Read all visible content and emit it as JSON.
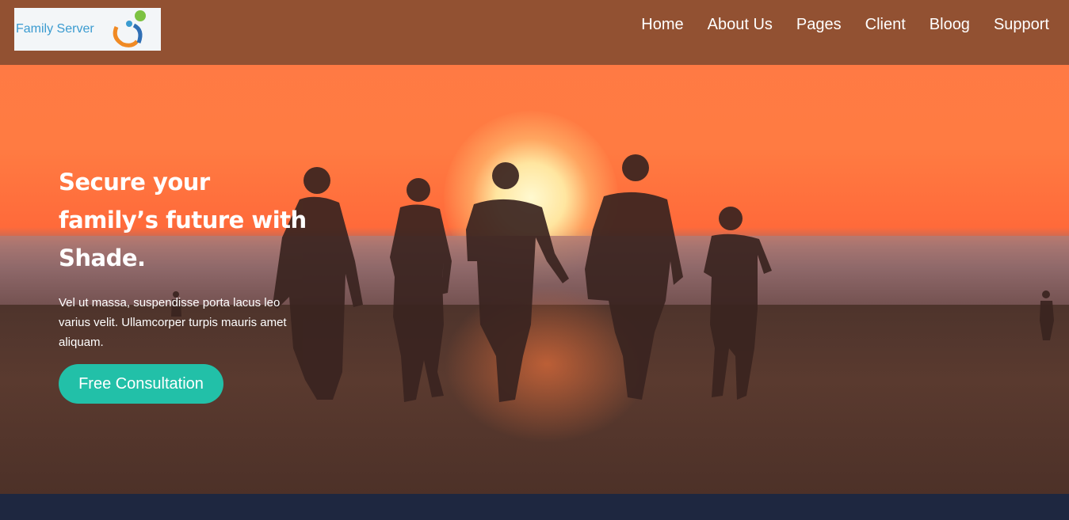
{
  "header": {
    "logo_text": "Family Server",
    "nav": [
      {
        "label": "Home"
      },
      {
        "label": "About Us"
      },
      {
        "label": "Pages"
      },
      {
        "label": "Client"
      },
      {
        "label": "Bloog"
      },
      {
        "label": "Support"
      }
    ]
  },
  "hero": {
    "headline": "Secure your family’s future with Shade.",
    "description": "Vel ut massa, suspendisse porta lacus leo varius velit. Ullamcorper turpis mauris amet aliquam.",
    "cta_label": "Free Consultation"
  },
  "colors": {
    "accent": "#22c0a8",
    "navbar": "#7a482e",
    "footer_strip": "#1e2740"
  }
}
